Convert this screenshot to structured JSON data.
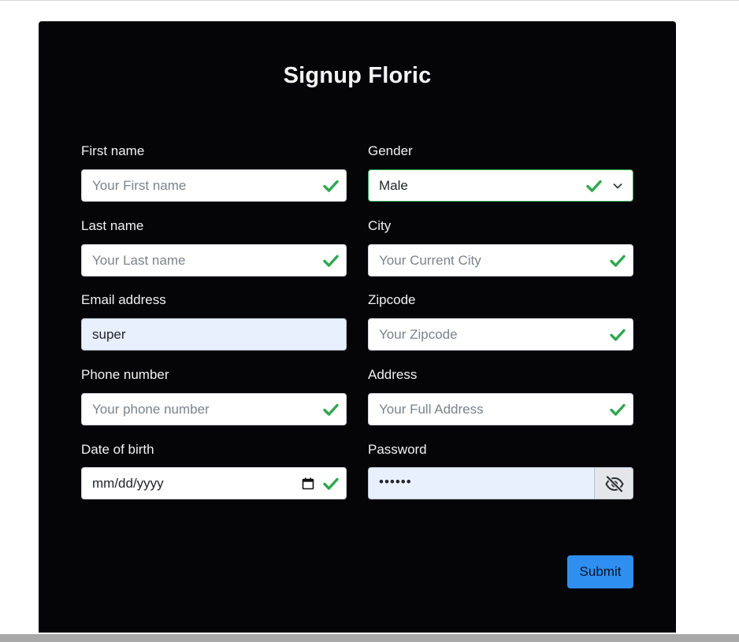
{
  "form": {
    "title": "Signup Floric",
    "first_name": {
      "label": "First name",
      "placeholder": "Your First name",
      "valid": true
    },
    "last_name": {
      "label": "Last name",
      "placeholder": "Your Last name",
      "valid": true
    },
    "email": {
      "label": "Email address",
      "value": "super"
    },
    "phone": {
      "label": "Phone number",
      "placeholder": "Your phone number",
      "valid": true
    },
    "dob": {
      "label": "Date of birth",
      "placeholder": "mm/dd/yyyy",
      "valid": true
    },
    "gender": {
      "label": "Gender",
      "value": "Male",
      "valid": true
    },
    "city": {
      "label": "City",
      "placeholder": "Your Current City",
      "valid": true
    },
    "zipcode": {
      "label": "Zipcode",
      "placeholder": "Your Zipcode",
      "valid": true
    },
    "address": {
      "label": "Address",
      "placeholder": "Your Full Address",
      "valid": true
    },
    "password": {
      "label": "Password",
      "value": "••••••"
    },
    "submit_label": "Submit"
  },
  "icons": {
    "check": "check-icon",
    "chevron": "chevron-down-icon",
    "calendar": "calendar-icon",
    "eye_slash": "eye-slash-icon"
  },
  "colors": {
    "card_background": "#050407",
    "valid_green": "#2ea84f",
    "submit_blue": "#2f8ff0",
    "autofill_background": "#e8f0fe"
  }
}
